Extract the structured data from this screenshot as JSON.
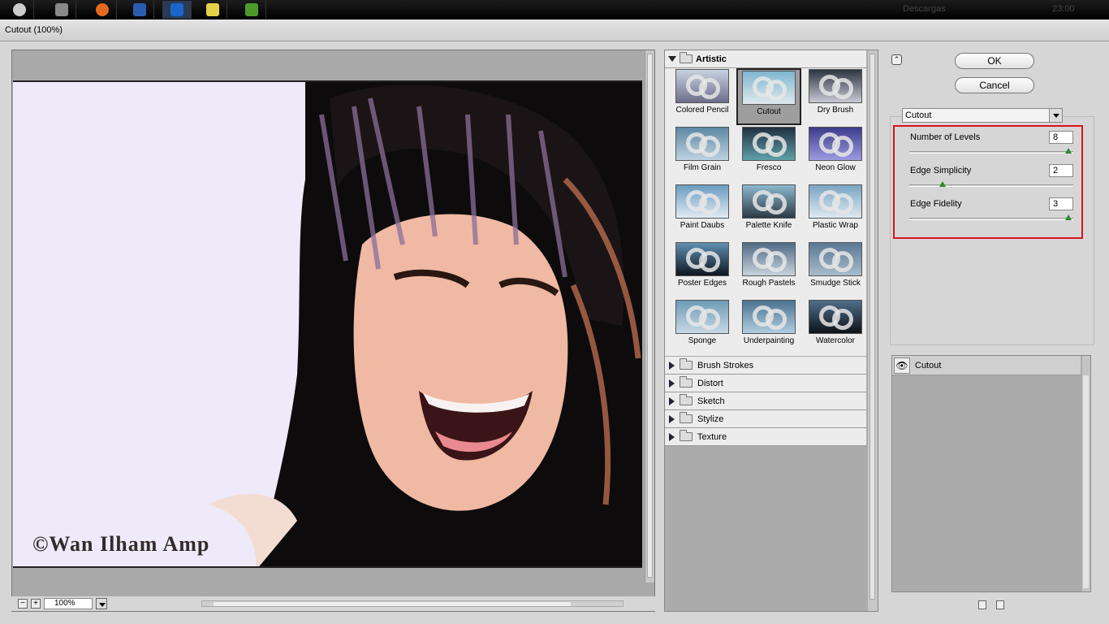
{
  "taskbar": {
    "language": "Descargas",
    "clock": "23:00"
  },
  "window": {
    "title": "Cutout (100%)"
  },
  "preview": {
    "watermark": "©Wan Ilham Amp",
    "zoom": "100%"
  },
  "gallery": {
    "open_category": "Artistic",
    "filters": [
      {
        "label": "Colored Pencil"
      },
      {
        "label": "Cutout"
      },
      {
        "label": "Dry Brush"
      },
      {
        "label": "Film Grain"
      },
      {
        "label": "Fresco"
      },
      {
        "label": "Neon Glow"
      },
      {
        "label": "Paint Daubs"
      },
      {
        "label": "Palette Knife"
      },
      {
        "label": "Plastic Wrap"
      },
      {
        "label": "Poster Edges"
      },
      {
        "label": "Rough Pastels"
      },
      {
        "label": "Smudge Stick"
      },
      {
        "label": "Sponge"
      },
      {
        "label": "Underpainting"
      },
      {
        "label": "Watercolor"
      }
    ],
    "selected_filter": "Cutout",
    "other_categories": [
      "Brush Strokes",
      "Distort",
      "Sketch",
      "Stylize",
      "Texture"
    ]
  },
  "dialog": {
    "ok_label": "OK",
    "cancel_label": "Cancel",
    "filter_select": "Cutout"
  },
  "params": [
    {
      "label": "Number of Levels",
      "value": "8",
      "level": 1.0
    },
    {
      "label": "Edge Simplicity",
      "value": "2",
      "level": 0.2
    },
    {
      "label": "Edge Fidelity",
      "value": "3",
      "level": 1.0
    }
  ],
  "layers": {
    "items": [
      {
        "label": "Cutout",
        "visible": true
      }
    ]
  },
  "colors": {
    "highlight": "#d8151b",
    "slider_knob": "#2d8a2d",
    "panel_bg": "#d6d6d6"
  }
}
